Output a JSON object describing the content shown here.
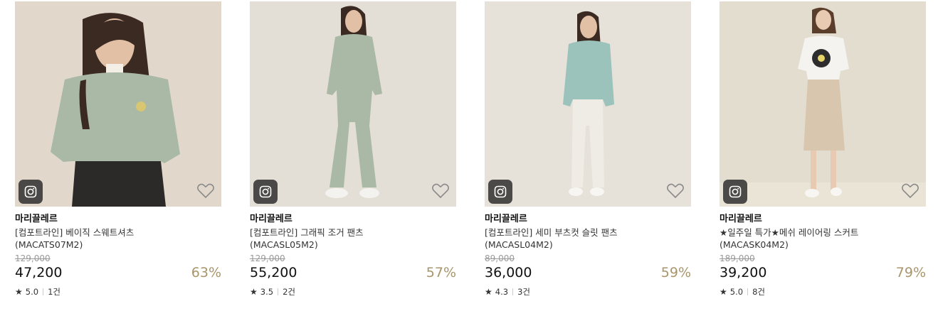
{
  "products": [
    {
      "brand": "마리끌레르",
      "name_line1": "[컴포트라인] 베이직 스웨트셔츠",
      "name_line2": "(MACATS07M2)",
      "original_price": "129,000",
      "price": "47,200",
      "discount": "63%",
      "star": "★",
      "rating": "5.0",
      "reviews": "1건",
      "image_subject": "model in mint sweatshirt and black leather pants",
      "colors": {
        "background": "#ddd3c6",
        "top": "#a9b9a6",
        "bottom": "#2b2a28",
        "hair": "#3a2a22"
      }
    },
    {
      "brand": "마리끌레르",
      "name_line1": "[컴포트라인] 그래픽 조거 팬츠",
      "name_line2": "(MACASL05M2)",
      "original_price": "129,000",
      "price": "55,200",
      "discount": "57%",
      "star": "★",
      "rating": "3.5",
      "reviews": "2건",
      "image_subject": "model in mint sweatshirt and jogger pants set",
      "colors": {
        "background": "#e4dfd6",
        "top": "#a9b9a6",
        "bottom": "#a9b9a6",
        "hair": "#3a2a22"
      }
    },
    {
      "brand": "마리끌레르",
      "name_line1": "[컴포트라인] 세미 부츠컷 슬릿 팬츠",
      "name_line2": "(MACASL04M2)",
      "original_price": "89,000",
      "price": "36,000",
      "discount": "59%",
      "star": "★",
      "rating": "4.3",
      "reviews": "3건",
      "image_subject": "model in mint hoodie and white slit pants",
      "colors": {
        "background": "#e6e1d9",
        "top": "#9bc3bc",
        "bottom": "#efece5",
        "hair": "#3a2a22"
      }
    },
    {
      "brand": "마리끌레르",
      "name_line1": "★일주일 특가★메쉬 레이어링 스커트",
      "name_line2": "(MACASK04M2)",
      "original_price": "189,000",
      "price": "39,200",
      "discount": "79%",
      "star": "★",
      "rating": "5.0",
      "reviews": "8건",
      "image_subject": "model in white graphic tee and beige layered skirt",
      "colors": {
        "background": "#e3ddd0",
        "top": "#f4f3ef",
        "bottom": "#d8c6ae",
        "hair": "#5a3d2b"
      }
    }
  ],
  "icons": {
    "instagram": "instagram-icon",
    "wishlist": "heart-icon",
    "rating": "star-icon"
  },
  "colors": {
    "discount": "#a8956b",
    "original_price": "#999999"
  }
}
